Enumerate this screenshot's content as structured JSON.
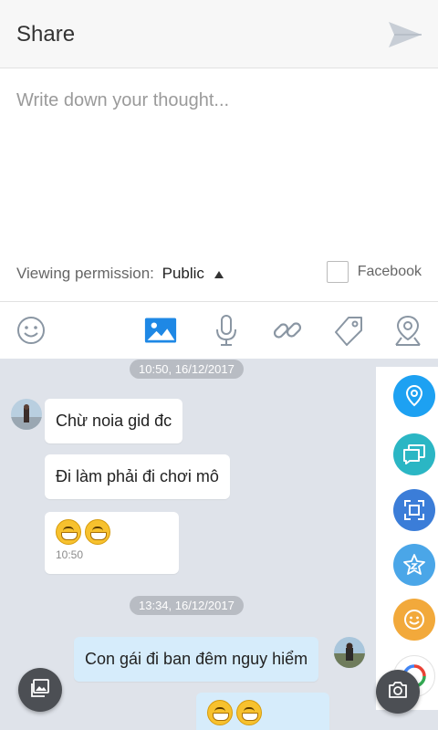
{
  "header": {
    "title": "Share",
    "send_icon": "send-icon"
  },
  "compose": {
    "placeholder": "Write down your thought...",
    "permission_label": "Viewing permission:",
    "permission_value": "Public",
    "facebook_label": "Facebook",
    "facebook_checked": false
  },
  "toolbar": {
    "active_color": "#1e88e5",
    "items": [
      "emoji-icon",
      "image-icon",
      "microphone-icon",
      "link-icon",
      "tag-icon",
      "location-icon"
    ],
    "active_item": "image-icon"
  },
  "chat": {
    "timestamps": [
      "10:50, 16/12/2017",
      "13:34, 16/12/2017"
    ],
    "messages": [
      {
        "text": "Chừ noia gid đc",
        "side": "left"
      },
      {
        "text": "Đi làm phải đi chơi mô",
        "side": "left"
      },
      {
        "emoji": "grin-emoji",
        "count": 2,
        "time": "10:50",
        "side": "left"
      },
      {
        "text": "Con gái đi ban đêm nguy hiểm",
        "side": "right"
      },
      {
        "emoji": "grin-emoji",
        "count": 2,
        "side": "right"
      }
    ]
  },
  "rail": {
    "items": [
      {
        "icon": "location-pin-icon",
        "color": "#1da1f2"
      },
      {
        "icon": "chat-cards-icon",
        "color": "#2bb6c4"
      },
      {
        "icon": "scan-frame-icon",
        "color": "#3b7dd8"
      },
      {
        "icon": "star-badge-icon",
        "color": "#4aa6e8"
      },
      {
        "icon": "smiley-icon",
        "color": "#f2a93b"
      }
    ]
  }
}
